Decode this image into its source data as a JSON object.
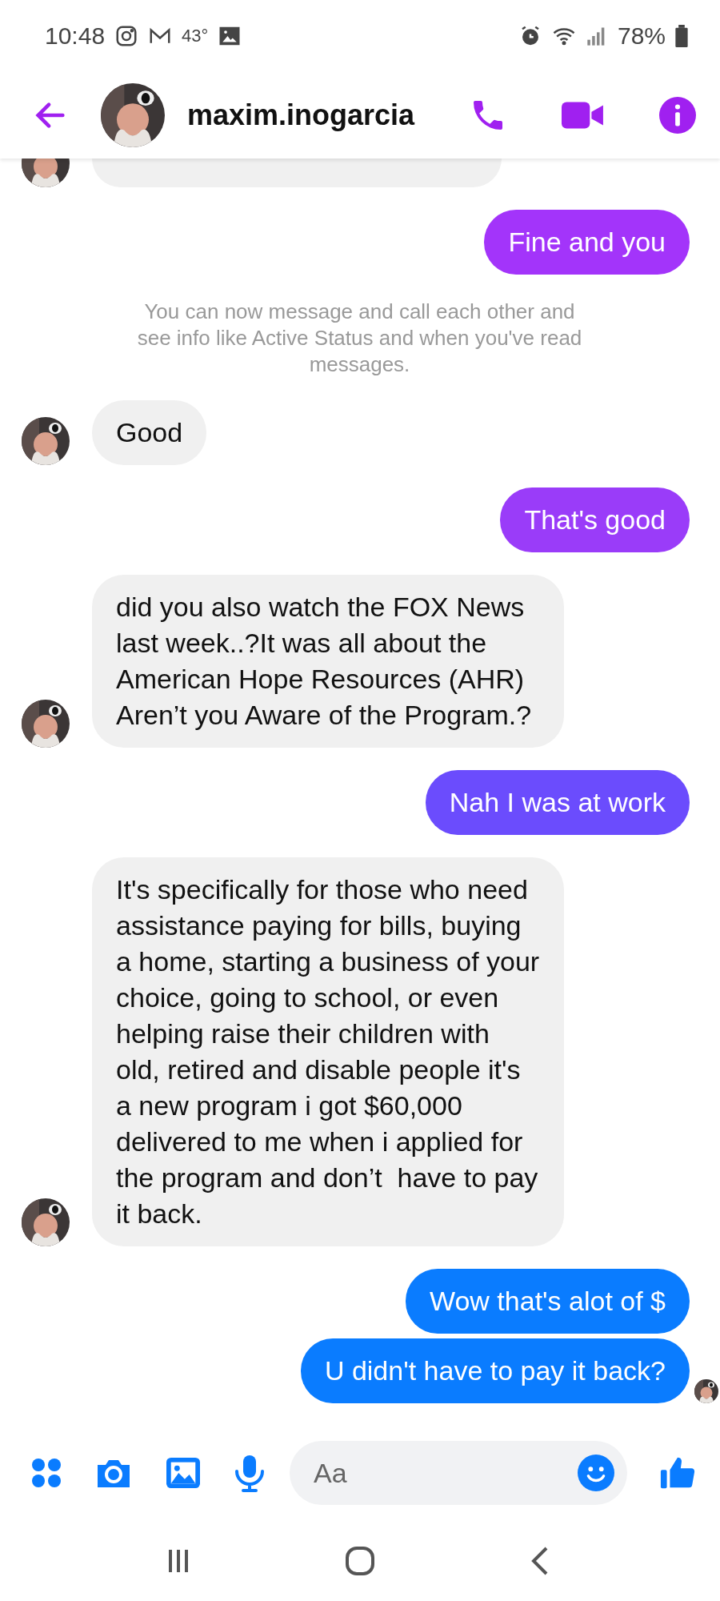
{
  "status_bar": {
    "time": "10:48",
    "temperature": "43°",
    "battery": "78%"
  },
  "header": {
    "name": "maxim.inogarcia"
  },
  "messages": [
    {
      "kind": "clipped",
      "seen": false
    },
    {
      "kind": "outgoing",
      "text": "Fine and you",
      "color": "#a334fa",
      "seen": false
    },
    {
      "kind": "notice",
      "text": "You can now message and call each other and see info like Active Status and when you've read messages."
    },
    {
      "kind": "incoming",
      "text": "Good",
      "seen": false
    },
    {
      "kind": "outgoing",
      "text": "That's good",
      "color": "#9a3cf9",
      "seen": false
    },
    {
      "kind": "incoming",
      "text": "did you also watch the FOX News last week..?It was all about the American Hope Resources (AHR) Aren’t you Aware of the Program.?",
      "seen": false
    },
    {
      "kind": "outgoing",
      "text": "Nah I was at work",
      "color": "#6b4cfd",
      "seen": false
    },
    {
      "kind": "incoming",
      "text": "It's specifically for those who need assistance paying for bills, buying a home, starting a business of your choice, going to school, or even helping raise their children with old, retired and disable people it's a new program i got $60,000 delivered to me when i applied for the program and don’t  have to pay it back.",
      "seen": false
    },
    {
      "kind": "outgoing",
      "text": "Wow that's alot of $",
      "color": "#0a7cff",
      "seen": false
    },
    {
      "kind": "outgoing",
      "text": "U didn't have to pay it back?",
      "color": "#0a7cff",
      "seen": true
    }
  ],
  "composer": {
    "placeholder": "Aa"
  }
}
